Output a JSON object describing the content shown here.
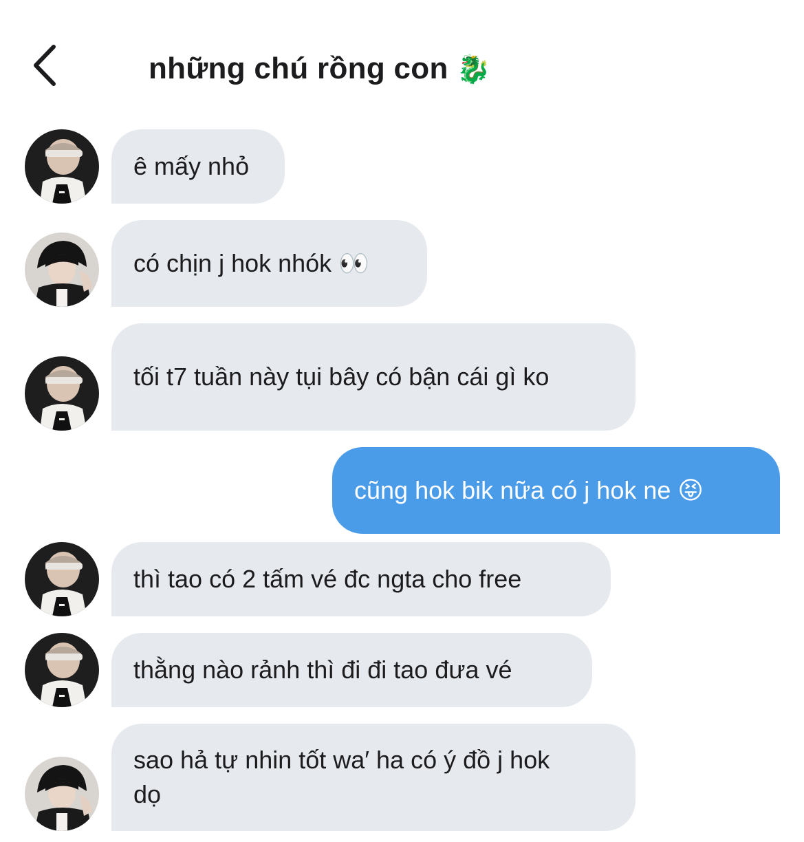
{
  "header": {
    "title": "những chú rồng con",
    "title_emoji": "🐉"
  },
  "messages": [
    {
      "sender": "avatar-a",
      "direction": "incoming",
      "text": "ê mấy nhỏ"
    },
    {
      "sender": "avatar-b",
      "direction": "incoming",
      "text": "có chịn j hok nhók 👀"
    },
    {
      "sender": "avatar-a",
      "direction": "incoming",
      "text": "tối t7 tuần này tụi bây có bận cái gì ko"
    },
    {
      "sender": "me",
      "direction": "outgoing",
      "text": "cũng hok bik nữa có j hok ne 😝"
    },
    {
      "sender": "avatar-a",
      "direction": "incoming",
      "text": "thì tao có 2 tấm vé đc ngta cho free"
    },
    {
      "sender": "avatar-a",
      "direction": "incoming",
      "text": "thằng nào rảnh thì đi đi tao đưa vé"
    },
    {
      "sender": "avatar-b",
      "direction": "incoming",
      "text": "sao hả tự nhin tốt wa′ ha có ý đồ j hok dọ"
    }
  ],
  "colors": {
    "incoming_bubble": "#e6eaee",
    "outgoing_bubble": "#4a9be8",
    "outgoing_text": "#ffffff",
    "text": "#1c1c1e"
  },
  "icons": {
    "back": "chevron-left-icon"
  }
}
